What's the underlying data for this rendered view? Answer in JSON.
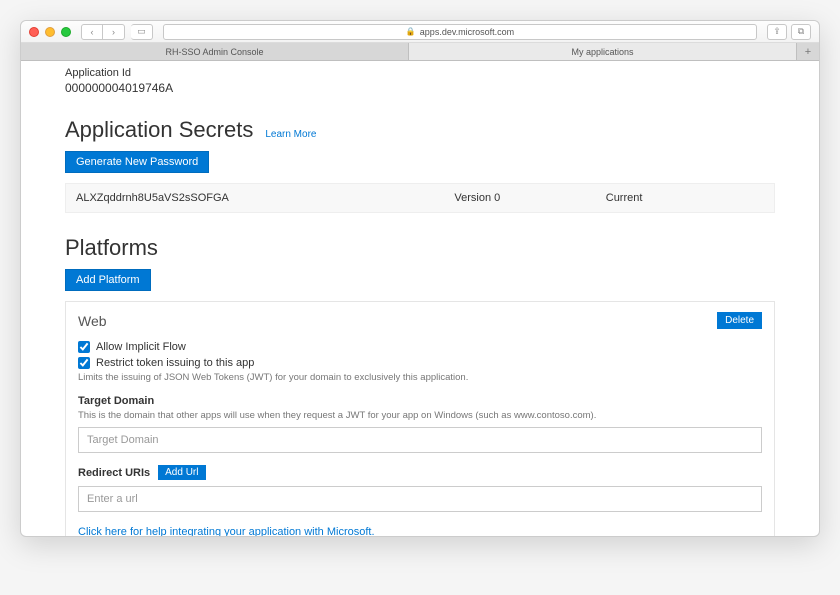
{
  "browser": {
    "address": "apps.dev.microsoft.com",
    "tabs": [
      {
        "label": "RH-SSO Admin Console",
        "active": false
      },
      {
        "label": "My applications",
        "active": true
      }
    ]
  },
  "app": {
    "id_label": "Application Id",
    "id_value": "000000004019746A"
  },
  "secrets": {
    "heading": "Application Secrets",
    "learn_more": "Learn More",
    "generate_btn": "Generate New Password",
    "rows": [
      {
        "value": "ALXZqddrnh8U5aVS2sSOFGA",
        "version": "Version 0",
        "status": "Current"
      }
    ]
  },
  "platforms": {
    "heading": "Platforms",
    "add_btn": "Add Platform",
    "card": {
      "title": "Web",
      "delete_btn": "Delete",
      "allow_implicit": {
        "checked": true,
        "label": "Allow Implicit Flow"
      },
      "restrict_token": {
        "checked": true,
        "label": "Restrict token issuing to this app"
      },
      "restrict_hint": "Limits the issuing of JSON Web Tokens (JWT) for your domain to exclusively this application.",
      "target_domain_label": "Target Domain",
      "target_domain_hint": "This is the domain that other apps will use when they request a JWT for your app on Windows (such as www.contoso.com).",
      "target_domain_placeholder": "Target Domain",
      "redirect_label": "Redirect URIs",
      "add_url_btn": "Add Url",
      "redirect_placeholder": "Enter a url",
      "help_link": "Click here for help integrating your application with Microsoft."
    }
  }
}
